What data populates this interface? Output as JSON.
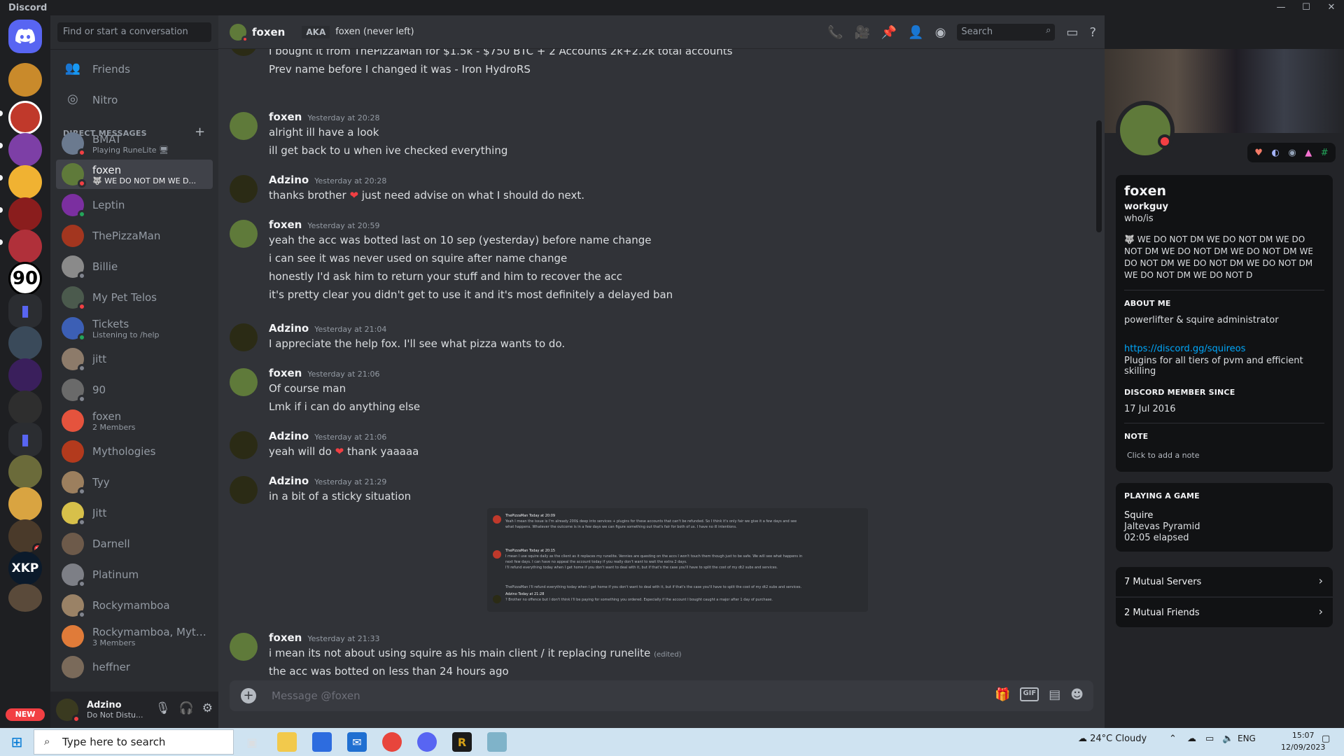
{
  "app": {
    "title": "Discord",
    "window_controls": [
      "—",
      "☐",
      "✕"
    ]
  },
  "dm_sidebar": {
    "search_placeholder": "Find or start a conversation",
    "friends_label": "Friends",
    "nitro_label": "Nitro",
    "direct_messages_header": "DIRECT MESSAGES",
    "dms": [
      {
        "name": "BMAT",
        "sub": "Playing RuneLite 🖥",
        "status": "dnd",
        "color": "#6b7a8f"
      },
      {
        "name": "foxen",
        "sub": "🐺 WE DO NOT DM WE D...",
        "status": "dnd",
        "color": "#5f7a3a"
      },
      {
        "name": "Leptin",
        "sub": "",
        "status": "on",
        "color": "#7b2fa0"
      },
      {
        "name": "ThePizzaMan",
        "sub": "",
        "status": "",
        "color": "#a3361f"
      },
      {
        "name": "Billie",
        "sub": "",
        "status": "off",
        "color": "#8a8a8a"
      },
      {
        "name": "My Pet Telos",
        "sub": "",
        "status": "dnd",
        "color": "#4b5a4d"
      },
      {
        "name": "Tickets",
        "sub": "Listening to /help",
        "status": "on",
        "color": "#3c5fb5"
      },
      {
        "name": "jitt",
        "sub": "",
        "status": "off",
        "color": "#8d7b6a"
      },
      {
        "name": "90",
        "sub": "",
        "status": "off",
        "color": "#6a6a6a"
      },
      {
        "name": "foxen",
        "sub": "2 Members",
        "status": "",
        "color": "#e5533d"
      },
      {
        "name": "Mythologies",
        "sub": "",
        "status": "",
        "color": "#b33a1d"
      },
      {
        "name": "Tyy",
        "sub": "",
        "status": "off",
        "color": "#9c7f5e"
      },
      {
        "name": "Jitt",
        "sub": "",
        "status": "off",
        "color": "#d7c04a"
      },
      {
        "name": "Darnell",
        "sub": "",
        "status": "",
        "color": "#6d5a4a"
      },
      {
        "name": "Platinum",
        "sub": "",
        "status": "off",
        "color": "#7d7f86"
      },
      {
        "name": "Rockymamboa",
        "sub": "",
        "status": "off",
        "color": "#9a8266"
      },
      {
        "name": "Rockymamboa, Myth...",
        "sub": "3 Members",
        "status": "",
        "color": "#e07b39"
      },
      {
        "name": "heffner",
        "sub": "",
        "status": "",
        "color": "#7a6a5a"
      }
    ]
  },
  "user_panel": {
    "name": "Adzino",
    "status_text": "Do Not Distu..."
  },
  "chat_header": {
    "name": "foxen",
    "aka_label": "AKA",
    "aka_value": "foxen (never left)",
    "search_placeholder": "Search"
  },
  "messages": [
    {
      "author": "",
      "timestamp": "",
      "lines": [
        "I bought it from ThePizzaMan for $1.5k - $750 BTC + 2 Accounts 2k+2.2k total accounts",
        "Prev name before I changed it was - Iron HydroRS"
      ]
    },
    {
      "author": "foxen",
      "timestamp": "Yesterday at 20:28",
      "lines": [
        "alright ill have a look",
        "ill get back to u when ive checked everything"
      ]
    },
    {
      "author": "Adzino",
      "timestamp": "Yesterday at 20:28",
      "lines": [
        "thanks brother",
        "just need advise on what I should do next."
      ]
    },
    {
      "author": "foxen",
      "timestamp": "Yesterday at 20:59",
      "lines": [
        "yeah the acc was botted last on 10 sep (yesterday) before name change",
        "i can see it was never used on squire after name change",
        "honestly I'd ask him to return your stuff and him to recover the acc",
        "it's pretty clear you didn't get to use it and it's most definitely a delayed ban"
      ]
    },
    {
      "author": "Adzino",
      "timestamp": "Yesterday at 21:04",
      "lines": [
        "I appreciate the help fox. I'll see what pizza wants to do."
      ]
    },
    {
      "author": "foxen",
      "timestamp": "Yesterday at 21:06",
      "lines": [
        "Of course man",
        "Lmk if i can do anything else"
      ]
    },
    {
      "author": "Adzino",
      "timestamp": "Yesterday at 21:06",
      "lines": [
        "yeah will do",
        "thank yaaaaa"
      ]
    },
    {
      "author": "Adzino",
      "timestamp": "Yesterday at 21:29",
      "lines": [
        "in a bit of a sticky situation"
      ]
    },
    {
      "author": "foxen",
      "timestamp": "Yesterday at 21:33",
      "lines": [
        "i mean its not about using squire as his main client / it replacing runelite",
        "the acc was botted on less than 24 hours ago"
      ],
      "edited": "(edited)"
    }
  ],
  "embed": {
    "lines": [
      "ThePizzaMan  Today at 20:09",
      "Yeah I mean the issue is I'm already 200$ deep into services + plugins for these accounts that can't be refunded. So I think it's only fair we give it a few days and see",
      "what happens. Whatever the outcome is in a few days we can figure something out that's fair for both of us. I have no ill intentions.",
      "ThePizzaMan  Today at 20:15",
      "I mean I use squire daily as the client as it replaces my runelite. Vennies are questing on the accs I won't touch them though just to be safe. We will see what happens in",
      "next few days. I can have no appeal the account today if you really don't want to wait the extra 2 days.",
      "I'll refund everything today when I get home if you don't want to deal with it, but if that's the case you'll have to split the cost of my dt2 subs and services.",
      "ThePizzaMan  I'll refund everything today when I get home if you don't want to deal with it, but if that's the case you'll have to split the cost of my dt2 subs and services.",
      "Adzino  Today at 21:28",
      "? Brother no offence but I don't think I'll be paying for something you ordered. Especially if the account I bought caught a major after 1 day of purchase."
    ]
  },
  "composer": {
    "placeholder": "Message @foxen",
    "gif_label": "GIF"
  },
  "profile": {
    "display_name": "foxen",
    "username": "workguy",
    "pronouns": "who/is",
    "custom_status": "🐺 WE DO NOT DM WE DO NOT DM WE DO NOT DM WE DO NOT DM WE DO NOT DM WE DO NOT DM WE DO NOT DM WE DO NOT DM WE DO NOT DM WE DO NOT D",
    "about_me_header": "ABOUT ME",
    "about_me": "powerlifter & squire administrator",
    "link": "https://discord.gg/squireos",
    "about_me_extra": "Plugins for all tiers of pvm and efficient skilling",
    "member_since_header": "DISCORD MEMBER SINCE",
    "member_since": "17 Jul 2016",
    "note_header": "NOTE",
    "note_placeholder": "Click to add a note",
    "game_header": "PLAYING A GAME",
    "game_name": "Squire",
    "game_detail": "Jaltevas Pyramid",
    "game_elapsed": "02:05 elapsed",
    "mutual_servers": "7 Mutual Servers",
    "mutual_friends": "2 Mutual Friends"
  },
  "guilds": {
    "new_label": "NEW",
    "badge_count": "1",
    "labels": [
      "90",
      "XKP"
    ]
  },
  "taskbar": {
    "search_placeholder": "Type here to search",
    "weather": "24°C  Cloudy",
    "language": "ENG",
    "time": "15:07",
    "date": "12/09/2023"
  },
  "colors": {
    "accent": "#5865f2",
    "dnd": "#f23f43",
    "online": "#23a55a",
    "link": "#00a8fc"
  }
}
